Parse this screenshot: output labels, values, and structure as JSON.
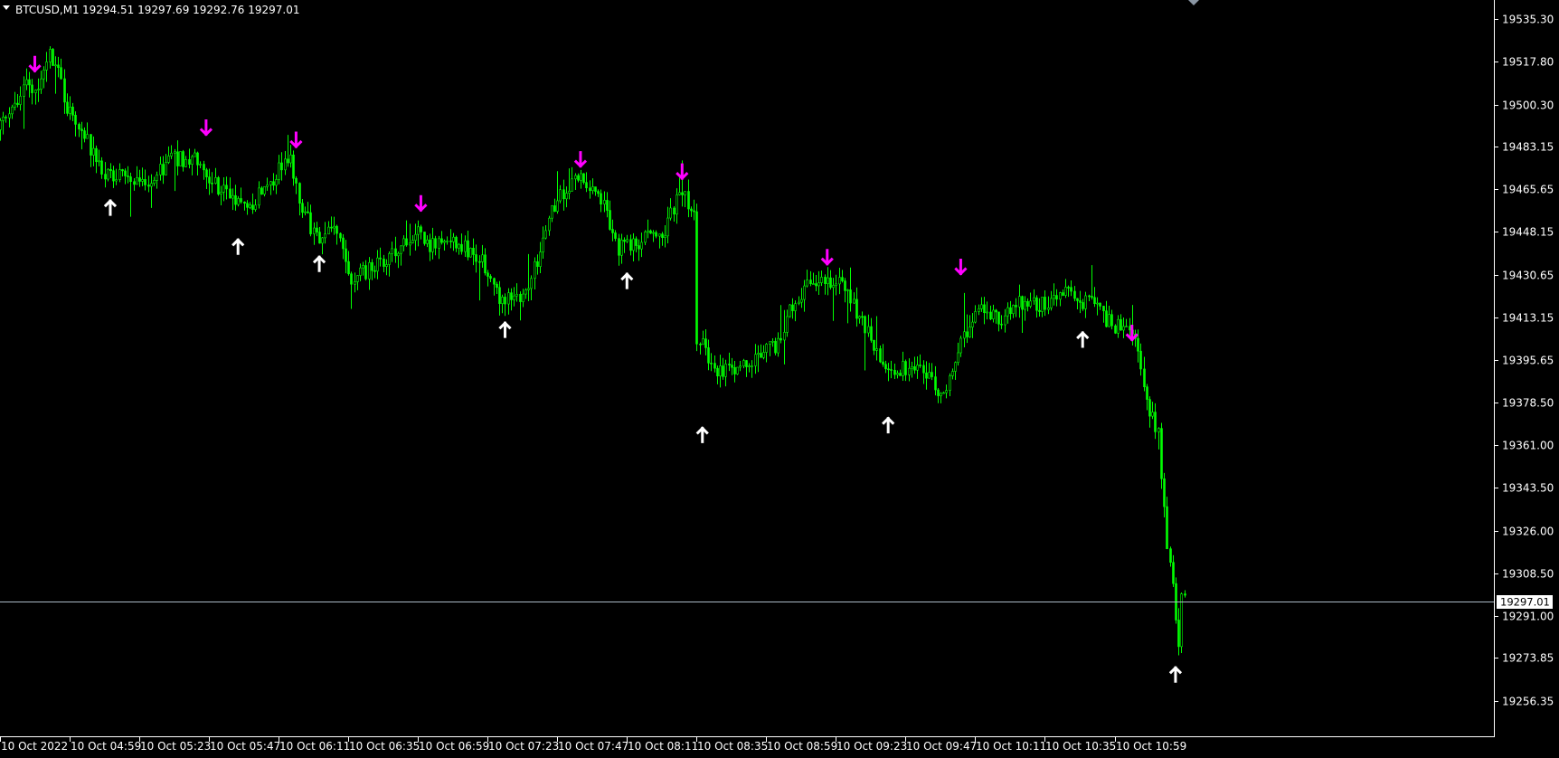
{
  "window": {
    "symbol": "BTCUSD,M1",
    "ohlc": "19294.51 19297.69 19292.76 19297.01"
  },
  "colors": {
    "background": "#000000",
    "candle": "#00ff00",
    "sell_arrow": "#ff00ff",
    "buy_arrow": "#ffffff",
    "current_price_line": "#a9b8c4",
    "axis": "#ffffff"
  },
  "chart_data": {
    "type": "candlestick",
    "symbol": "BTCUSD",
    "timeframe": "M1",
    "ylim": [
      19248.5,
      19539.0
    ],
    "y_ticks": [
      19535.3,
      19517.8,
      19500.3,
      19483.15,
      19465.65,
      19448.15,
      19430.65,
      19413.15,
      19395.65,
      19378.5,
      19361.0,
      19343.5,
      19326.0,
      19308.5,
      19291.0,
      19273.85,
      19256.35
    ],
    "y_tick_labels": [
      "19535.30",
      "19517.80",
      "19500.30",
      "19483.15",
      "19465.65",
      "19448.15",
      "19430.65",
      "19413.15",
      "19395.65",
      "19378.50",
      "19361.00",
      "19343.50",
      "19326.00",
      "19308.50",
      "19291.00",
      "19273.85",
      "19256.35"
    ],
    "x_range_minutes": [
      0,
      515
    ],
    "x_ticks": [
      0,
      24,
      48,
      72,
      96,
      120,
      144,
      168,
      192,
      216,
      240,
      264,
      288,
      312,
      336,
      360,
      384
    ],
    "x_tick_labels": [
      "10 Oct 2022",
      "10 Oct 04:59",
      "10 Oct 05:23",
      "10 Oct 05:47",
      "10 Oct 06:11",
      "10 Oct 06:35",
      "10 Oct 06:59",
      "10 Oct 07:23",
      "10 Oct 07:47",
      "10 Oct 08:11",
      "10 Oct 08:35",
      "10 Oct 08:59",
      "10 Oct 09:23",
      "10 Oct 09:47",
      "10 Oct 10:11",
      "10 Oct 10:35",
      "10 Oct 10:59"
    ],
    "current_price": 19297.01,
    "current_price_label": "19297.01",
    "price_path": [
      [
        0,
        19490
      ],
      [
        5,
        19500
      ],
      [
        10,
        19507
      ],
      [
        14,
        19504
      ],
      [
        18,
        19522
      ],
      [
        21,
        19515
      ],
      [
        24,
        19498
      ],
      [
        30,
        19488
      ],
      [
        36,
        19472
      ],
      [
        44,
        19472
      ],
      [
        52,
        19468
      ],
      [
        60,
        19478
      ],
      [
        70,
        19478
      ],
      [
        74,
        19468
      ],
      [
        82,
        19462
      ],
      [
        88,
        19460
      ],
      [
        96,
        19472
      ],
      [
        101,
        19478
      ],
      [
        104,
        19462
      ],
      [
        110,
        19445
      ],
      [
        117,
        19450
      ],
      [
        121,
        19428
      ],
      [
        132,
        19435
      ],
      [
        140,
        19445
      ],
      [
        145,
        19447
      ],
      [
        150,
        19442
      ],
      [
        158,
        19444
      ],
      [
        166,
        19438
      ],
      [
        172,
        19422
      ],
      [
        182,
        19422
      ],
      [
        187,
        19440
      ],
      [
        192,
        19460
      ],
      [
        200,
        19470
      ],
      [
        208,
        19462
      ],
      [
        214,
        19442
      ],
      [
        221,
        19444
      ],
      [
        230,
        19450
      ],
      [
        236,
        19465
      ],
      [
        238,
        19460
      ],
      [
        240,
        19455
      ],
      [
        241,
        19405
      ],
      [
        248,
        19392
      ],
      [
        260,
        19395
      ],
      [
        268,
        19402
      ],
      [
        275,
        19420
      ],
      [
        281,
        19428
      ],
      [
        290,
        19428
      ],
      [
        298,
        19412
      ],
      [
        305,
        19392
      ],
      [
        313,
        19393
      ],
      [
        318,
        19392
      ],
      [
        326,
        19382
      ],
      [
        333,
        19405
      ],
      [
        338,
        19420
      ],
      [
        345,
        19412
      ],
      [
        352,
        19420
      ],
      [
        362,
        19418
      ],
      [
        368,
        19423
      ],
      [
        378,
        19418
      ],
      [
        384,
        19410
      ],
      [
        390,
        19408
      ],
      [
        393,
        19402
      ],
      [
        396,
        19380
      ],
      [
        400,
        19365
      ],
      [
        403,
        19320
      ],
      [
        407,
        19282
      ],
      [
        408,
        19300
      ]
    ],
    "signals": [
      {
        "type": "sell",
        "minute": 12,
        "price": 19513
      },
      {
        "type": "buy",
        "minute": 38,
        "price": 19462
      },
      {
        "type": "sell",
        "minute": 71,
        "price": 19487
      },
      {
        "type": "buy",
        "minute": 82,
        "price": 19446
      },
      {
        "type": "sell",
        "minute": 102,
        "price": 19482
      },
      {
        "type": "buy",
        "minute": 110,
        "price": 19439
      },
      {
        "type": "sell",
        "minute": 145,
        "price": 19456
      },
      {
        "type": "buy",
        "minute": 174,
        "price": 19412
      },
      {
        "type": "sell",
        "minute": 200,
        "price": 19474
      },
      {
        "type": "buy",
        "minute": 216,
        "price": 19432
      },
      {
        "type": "sell",
        "minute": 235,
        "price": 19469
      },
      {
        "type": "buy",
        "minute": 242,
        "price": 19369
      },
      {
        "type": "sell",
        "minute": 285,
        "price": 19434
      },
      {
        "type": "buy",
        "minute": 306,
        "price": 19373
      },
      {
        "type": "sell",
        "minute": 331,
        "price": 19430
      },
      {
        "type": "buy",
        "minute": 373,
        "price": 19408
      },
      {
        "type": "sell",
        "minute": 390,
        "price": 19403
      },
      {
        "type": "buy",
        "minute": 405,
        "price": 19271
      }
    ]
  }
}
